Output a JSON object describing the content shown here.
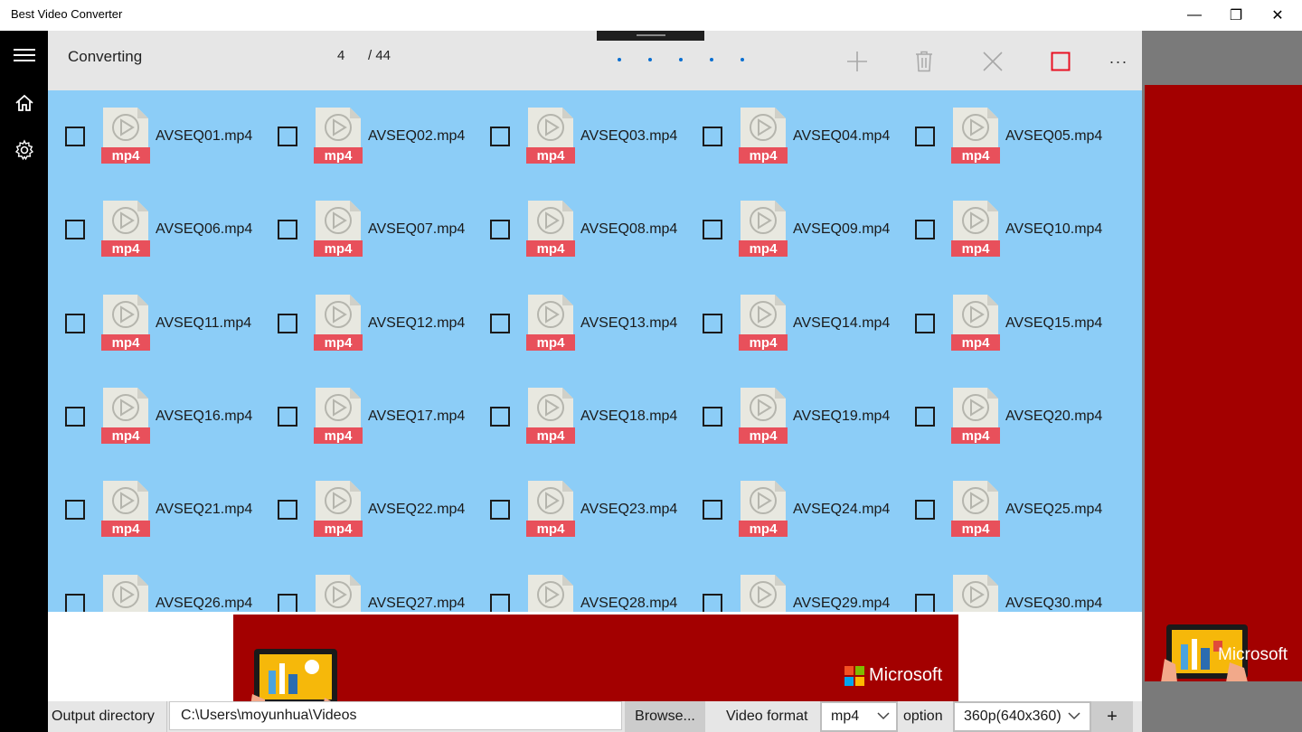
{
  "window": {
    "title": "Best Video Converter",
    "minimize_glyph": "—",
    "maximize_glyph": "❐",
    "close_glyph": "✕"
  },
  "sidebar": {
    "icons": [
      "hamburger-icon",
      "home-icon",
      "gear-icon"
    ]
  },
  "toolbar": {
    "status": "Converting",
    "current": "4",
    "total": "/ 44",
    "actions": [
      "add-icon",
      "delete-icon",
      "close-icon",
      "stop-icon",
      "more-icon"
    ],
    "more_glyph": "···"
  },
  "files": {
    "badge": "mp4",
    "items": [
      "AVSEQ01.mp4",
      "AVSEQ02.mp4",
      "AVSEQ03.mp4",
      "AVSEQ04.mp4",
      "AVSEQ05.mp4",
      "AVSEQ06.mp4",
      "AVSEQ07.mp4",
      "AVSEQ08.mp4",
      "AVSEQ09.mp4",
      "AVSEQ10.mp4",
      "AVSEQ11.mp4",
      "AVSEQ12.mp4",
      "AVSEQ13.mp4",
      "AVSEQ14.mp4",
      "AVSEQ15.mp4",
      "AVSEQ16.mp4",
      "AVSEQ17.mp4",
      "AVSEQ18.mp4",
      "AVSEQ19.mp4",
      "AVSEQ20.mp4",
      "AVSEQ21.mp4",
      "AVSEQ22.mp4",
      "AVSEQ23.mp4",
      "AVSEQ24.mp4",
      "AVSEQ25.mp4",
      "AVSEQ26.mp4",
      "AVSEQ27.mp4",
      "AVSEQ28.mp4",
      "AVSEQ29.mp4",
      "AVSEQ30.mp4"
    ]
  },
  "ads": {
    "brand": "Microsoft"
  },
  "bottombar": {
    "output_label": "Output directory",
    "output_value": "C:\\Users\\moyunhua\\Videos",
    "browse_label": "Browse...",
    "format_label": "Video format",
    "format_value": "mp4",
    "option_label": "option",
    "option_value": "360p(640x360)",
    "add_label": "+"
  },
  "colors": {
    "grid_bg": "#8ccdf7",
    "ad_red": "#a30000",
    "badge_red": "#e8505b",
    "accent_blue": "#0a6fd1",
    "stop_red": "#e81123"
  }
}
